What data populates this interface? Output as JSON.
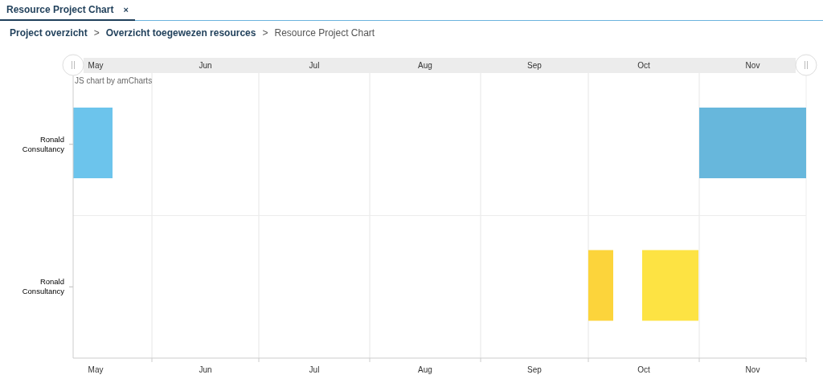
{
  "tabs": [
    {
      "label": "Resource Project Chart",
      "close": "×",
      "selected": true
    }
  ],
  "breadcrumbs": [
    {
      "label": "Project overzicht",
      "link": true
    },
    {
      "label": "Overzicht toegewezen resources",
      "link": true
    },
    {
      "label": "Resource Project Chart",
      "link": false
    }
  ],
  "breadcrumb_separator": ">",
  "chart": {
    "credit": "JS chart by amCharts",
    "months_top": [
      "May",
      "Jun",
      "Jul",
      "Aug",
      "Sep",
      "Oct",
      "Nov"
    ],
    "months_bottom": [
      "May",
      "Jun",
      "Jul",
      "Aug",
      "Sep",
      "Oct",
      "Nov"
    ],
    "rows": [
      {
        "label": "Ronald Consultancy",
        "tasks": [
          {
            "color": "#6cc4ec"
          },
          {
            "color": "#67b7dc"
          }
        ]
      },
      {
        "label": "Ronald Consultancy",
        "tasks": [
          {
            "color": "#fcd43b"
          },
          {
            "color": "#fde343"
          }
        ]
      }
    ]
  }
}
